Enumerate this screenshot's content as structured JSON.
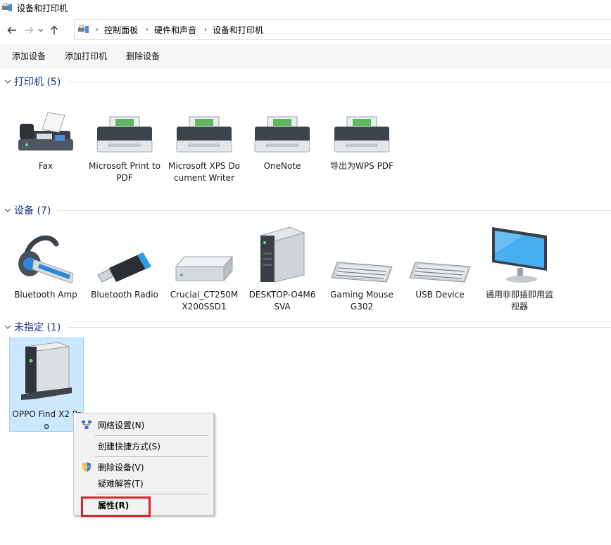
{
  "window": {
    "title": "设备和打印机"
  },
  "breadcrumb": [
    "控制面板",
    "硬件和声音",
    "设备和打印机"
  ],
  "toolbar": {
    "add_device": "添加设备",
    "add_printer": "添加打印机",
    "remove_device": "删除设备"
  },
  "groups": {
    "printers": {
      "title": "打印机 (5)"
    },
    "devices": {
      "title": "设备 (7)"
    },
    "unspecified": {
      "title": "未指定 (1)"
    }
  },
  "printers": [
    {
      "label": "Fax",
      "icon": "fax-icon"
    },
    {
      "label": "Microsoft Print to PDF",
      "icon": "printer-icon"
    },
    {
      "label": "Microsoft XPS Document Writer",
      "icon": "printer-icon"
    },
    {
      "label": "OneNote",
      "icon": "printer-icon"
    },
    {
      "label": "导出为WPS PDF",
      "icon": "printer-icon"
    }
  ],
  "devices": [
    {
      "label": "Bluetooth Amp",
      "icon": "headset-icon"
    },
    {
      "label": "Bluetooth Radio",
      "icon": "usb-dongle-icon"
    },
    {
      "label": "Crucial_CT250MX200SSD1",
      "icon": "drive-icon"
    },
    {
      "label": "DESKTOP-O4M6SVA",
      "icon": "computer-tower-icon"
    },
    {
      "label": "Gaming Mouse G302",
      "icon": "keyboard-icon"
    },
    {
      "label": "USB Device",
      "icon": "keyboard-icon"
    },
    {
      "label": "通用非即插即用监视器",
      "icon": "monitor-icon"
    }
  ],
  "unspecified": [
    {
      "label": "OPPO Find X2 Pro",
      "icon": "generic-device-icon"
    }
  ],
  "context_menu": {
    "network": "网络设置(N)",
    "shortcut": "创建快捷方式(S)",
    "remove": "删除设备(V)",
    "troubleshoot": "疑难解答(T)",
    "properties": "属性(R)"
  },
  "colors": {
    "group_header": "#1e3287",
    "selection": "#cce8ff",
    "highlight": "#e0202a"
  }
}
